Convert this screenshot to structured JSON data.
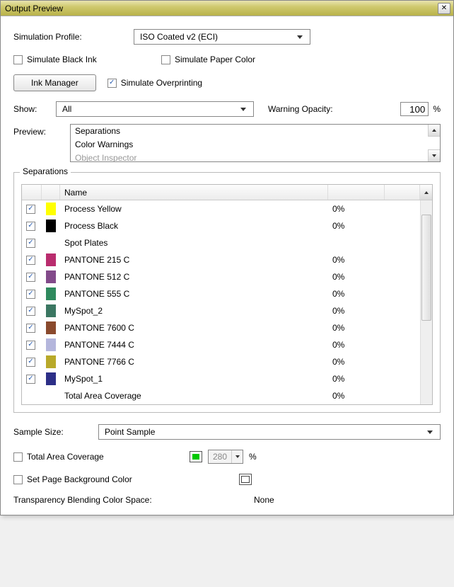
{
  "window": {
    "title": "Output Preview"
  },
  "simProfile": {
    "label": "Simulation Profile:",
    "value": "ISO Coated v2 (ECI)"
  },
  "simBlackInk": {
    "label": "Simulate Black Ink",
    "checked": false
  },
  "simPaperColor": {
    "label": "Simulate Paper Color",
    "checked": false
  },
  "inkManager": {
    "label": "Ink Manager"
  },
  "simOverprinting": {
    "label": "Simulate Overprinting",
    "checked": true
  },
  "show": {
    "label": "Show:",
    "value": "All"
  },
  "warningOpacity": {
    "label": "Warning Opacity:",
    "value": "100",
    "suffix": "%"
  },
  "preview": {
    "label": "Preview:",
    "items": [
      "Separations",
      "Color Warnings",
      "Object Inspector"
    ]
  },
  "separations": {
    "group_title": "Separations",
    "header_name": "Name",
    "rows": [
      {
        "checked": true,
        "color": "#ffff00",
        "name": "Process Yellow",
        "value": "0%"
      },
      {
        "checked": true,
        "color": "#000000",
        "name": "Process Black",
        "value": "0%"
      },
      {
        "checked": true,
        "color": "",
        "name": "Spot Plates",
        "value": ""
      },
      {
        "checked": true,
        "color": "#b92c6e",
        "name": "PANTONE 215 C",
        "value": "0%"
      },
      {
        "checked": true,
        "color": "#824a8a",
        "name": "PANTONE 512 C",
        "value": "0%"
      },
      {
        "checked": true,
        "color": "#2f8a5e",
        "name": "PANTONE 555 C",
        "value": "0%"
      },
      {
        "checked": true,
        "color": "#3b7762",
        "name": "MySpot_2",
        "value": "0%"
      },
      {
        "checked": true,
        "color": "#8a4a2d",
        "name": "PANTONE 7600 C",
        "value": "0%"
      },
      {
        "checked": true,
        "color": "#b4b6dc",
        "name": "PANTONE 7444 C",
        "value": "0%"
      },
      {
        "checked": true,
        "color": "#b8a92a",
        "name": "PANTONE 7766 C",
        "value": "0%"
      },
      {
        "checked": true,
        "color": "#2d2f87",
        "name": "MySpot_1",
        "value": "0%"
      },
      {
        "checked": false,
        "color": "",
        "name": "Total Area Coverage",
        "value": "0%",
        "nocheck": true
      }
    ]
  },
  "sampleSize": {
    "label": "Sample Size:",
    "value": "Point Sample"
  },
  "totalAreaCoverage": {
    "label": "Total Area Coverage",
    "checked": false,
    "color": "#00c800",
    "value": "280",
    "suffix": "%"
  },
  "setPageBg": {
    "label": "Set Page Background Color",
    "checked": false
  },
  "transparency": {
    "label": "Transparency Blending Color Space:",
    "value": "None"
  }
}
